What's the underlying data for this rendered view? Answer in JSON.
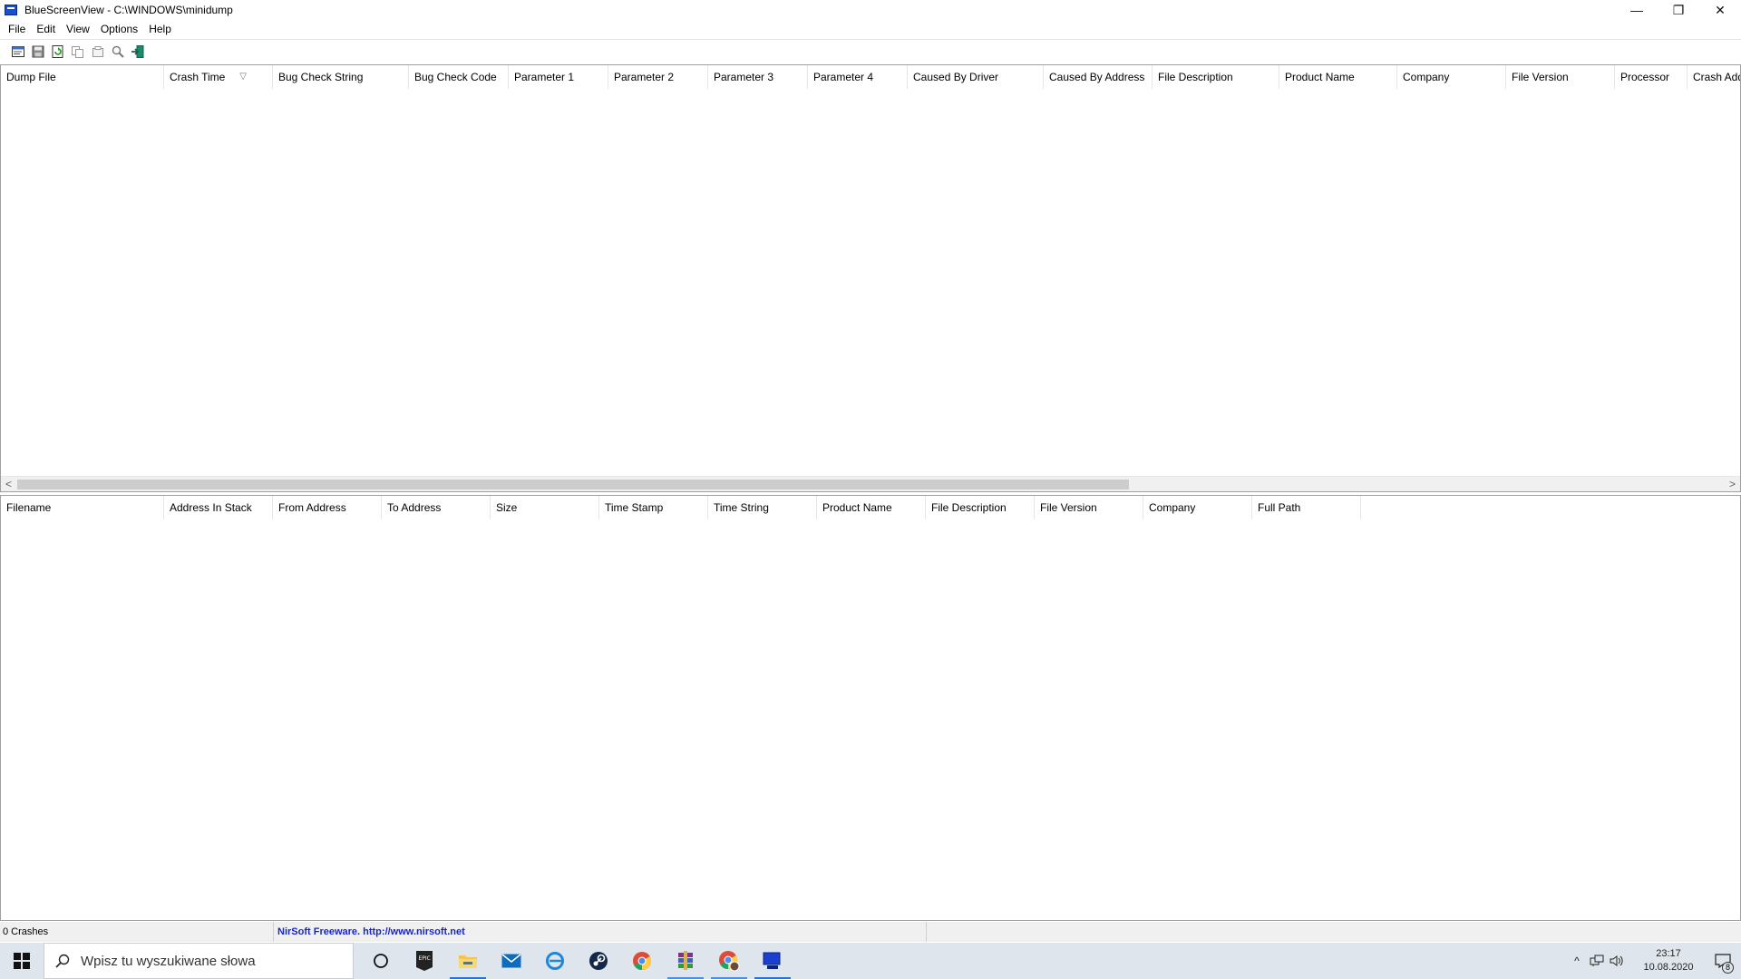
{
  "window": {
    "title": "BlueScreenView  -  C:\\WINDOWS\\minidump",
    "controls": {
      "minimize": "—",
      "restore": "❐",
      "close": "✕"
    }
  },
  "menu": [
    "File",
    "Edit",
    "View",
    "Options",
    "Help"
  ],
  "toolbar": {
    "buttons": [
      "properties-icon",
      "save-icon",
      "refresh-icon",
      "copy-icon",
      "html-report-icon",
      "find-icon",
      "exit-icon"
    ]
  },
  "top_table": {
    "columns": [
      "Dump File",
      "Crash Time",
      "Bug Check String",
      "Bug Check Code",
      "Parameter 1",
      "Parameter 2",
      "Parameter 3",
      "Parameter 4",
      "Caused By Driver",
      "Caused By Address",
      "File Description",
      "Product Name",
      "Company",
      "File Version",
      "Processor",
      "Crash Address"
    ],
    "sorted_column": "Crash Time",
    "sort_glyph": "▽",
    "rows": []
  },
  "scrollbar": {
    "left_arrow": "<",
    "right_arrow": ">",
    "position": 0.0
  },
  "bottom_table": {
    "columns": [
      "Filename",
      "Address In Stack",
      "From Address",
      "To Address",
      "Size",
      "Time Stamp",
      "Time String",
      "Product Name",
      "File Description",
      "File Version",
      "Company",
      "Full Path"
    ],
    "rows": []
  },
  "status": {
    "count_text": "0 Crashes",
    "freeware_text": "NirSoft Freeware.  http://www.nirsoft.net"
  },
  "taskbar": {
    "search_placeholder": "Wpisz tu wyszukiwane słowa",
    "apps": [
      "cortana-icon",
      "epic-games-icon",
      "file-explorer-icon",
      "mail-icon",
      "edge-icon",
      "steam-icon",
      "chrome-icon",
      "winrar-icon",
      "chrome-profile-icon",
      "bluescreenview-icon"
    ],
    "tray_chevron": "^",
    "time": "23:17",
    "date": "10.08.2020",
    "notification_count": "8"
  },
  "colors": {
    "accent": "#2b6fd6",
    "link": "#1a26c7",
    "taskbar": "#dfe5ec"
  }
}
